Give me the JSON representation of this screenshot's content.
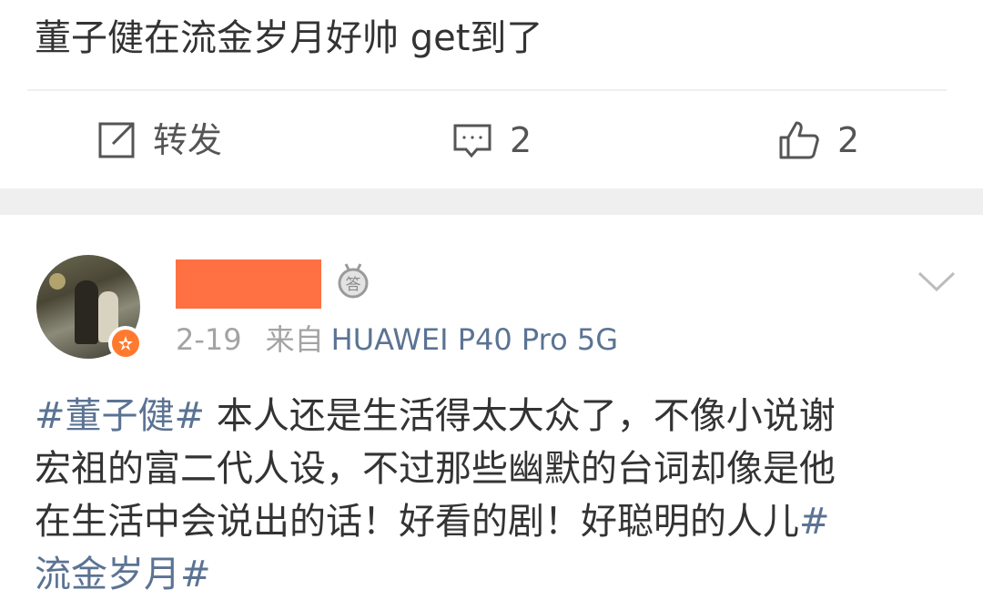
{
  "prev_post": {
    "text": "董子健在流金岁月好帅 get到了",
    "actions": {
      "repost_label": "转发",
      "comment_count": "2",
      "like_count": "2"
    }
  },
  "comment": {
    "badge_char": "答",
    "date": "2-19",
    "source_prefix": "来自",
    "device": "HUAWEI P40 Pro 5G",
    "lines": [
      {
        "tag": "#董子健#",
        "text": " 本人还是生活得太大众了，不像小说谢",
        "tag_end": ""
      },
      {
        "tag": "",
        "text": "宏祖的富二代人设，不过那些幽默的台词却像是他",
        "tag_end": ""
      },
      {
        "tag": "",
        "text": "在生活中会说出的话！好看的剧！好聪明的人儿",
        "tag_end": "#"
      },
      {
        "tag": "流金岁月#",
        "text": "",
        "tag_end": ""
      }
    ]
  },
  "colors": {
    "text": "#333333",
    "muted": "#a3a3a3",
    "link": "#5b7393",
    "redact": "#ff7043",
    "divider": "#efefef"
  },
  "icons": [
    "repost-icon",
    "comment-icon",
    "like-icon",
    "medal-icon",
    "verified-badge-icon",
    "chevron-down-icon"
  ]
}
